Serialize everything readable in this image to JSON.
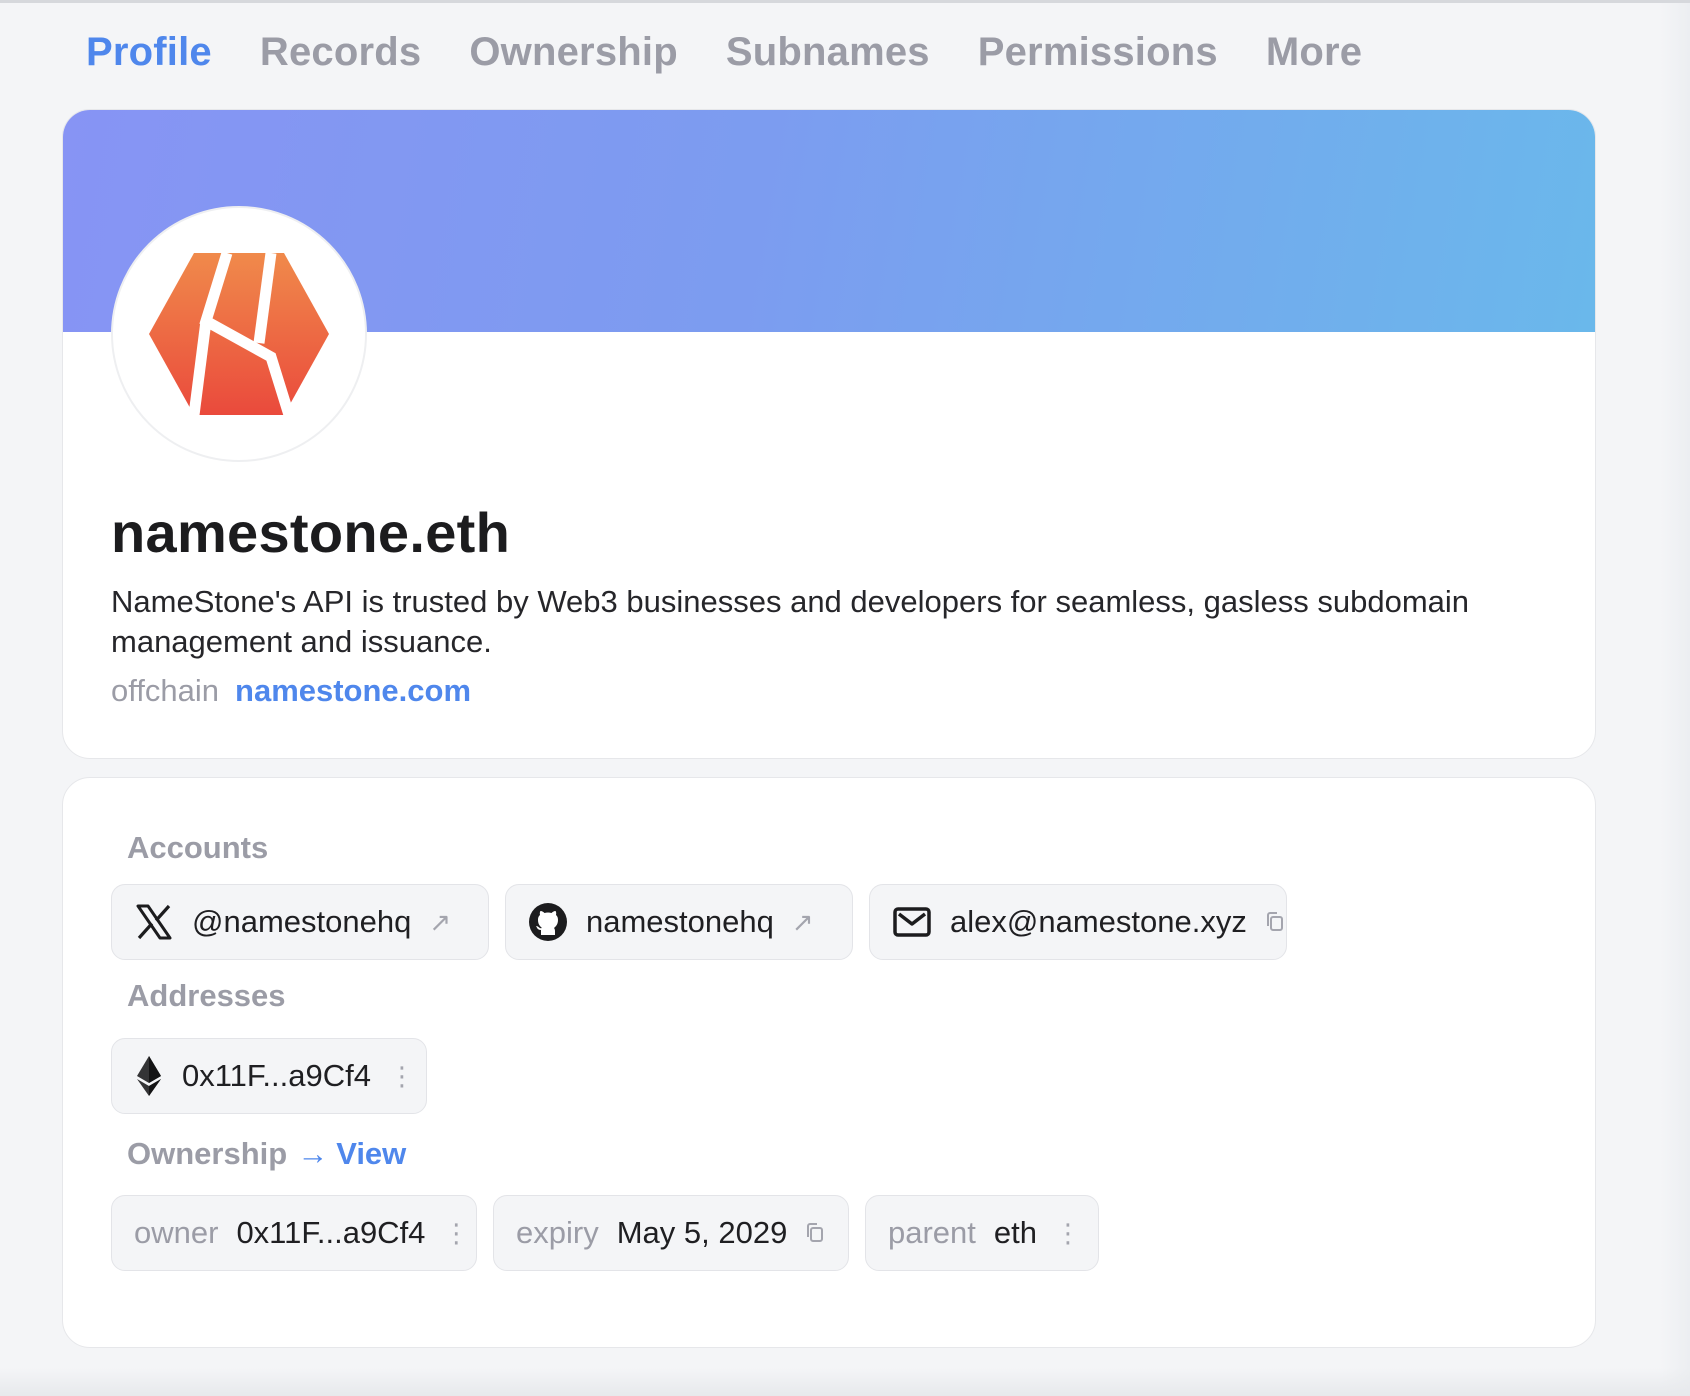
{
  "tabs": [
    {
      "label": "Profile",
      "active": true
    },
    {
      "label": "Records"
    },
    {
      "label": "Ownership"
    },
    {
      "label": "Subnames"
    },
    {
      "label": "Permissions"
    },
    {
      "label": "More"
    }
  ],
  "profile": {
    "name": "namestone.eth",
    "description": "NameStone's API is trusted by Web3 businesses and developers for seamless, gasless subdomain management and issuance.",
    "offchain_label": "offchain",
    "url_label": "namestone.com",
    "avatar_icon": "namestone-logo"
  },
  "accounts": {
    "label": "Accounts",
    "items": [
      {
        "icon": "x-twitter-icon",
        "text": "@namestonehq",
        "action_icon": "external-link-icon",
        "action_glyph": "↗"
      },
      {
        "icon": "github-icon",
        "text": "namestonehq",
        "action_icon": "external-link-icon",
        "action_glyph": "↗"
      },
      {
        "icon": "email-icon",
        "text": "alex@namestone.xyz",
        "action_icon": "copy-icon"
      }
    ]
  },
  "addresses": {
    "label": "Addresses",
    "items": [
      {
        "icon": "ethereum-icon",
        "text": "0x11F...a9Cf4",
        "action_icon": "more-vertical-icon",
        "action_glyph": "⋮"
      }
    ]
  },
  "ownership": {
    "label": "Ownership",
    "view_arrow": "→",
    "view_label": "View",
    "items": [
      {
        "key": "owner",
        "value": "0x11F...a9Cf4",
        "action_icon": "more-vertical-icon",
        "action_glyph": "⋮"
      },
      {
        "key": "expiry",
        "value": "May 5, 2029",
        "action_icon": "copy-icon"
      },
      {
        "key": "parent",
        "value": "eth",
        "action_icon": "more-vertical-icon",
        "action_glyph": "⋮"
      }
    ]
  },
  "colors": {
    "accent": "#4f87ec",
    "muted": "#9b9ca6",
    "banner_start": "#8794f4",
    "banner_end": "#6ab8eb",
    "logo_orange": "#f08a4b",
    "logo_red": "#ea4a3c"
  }
}
